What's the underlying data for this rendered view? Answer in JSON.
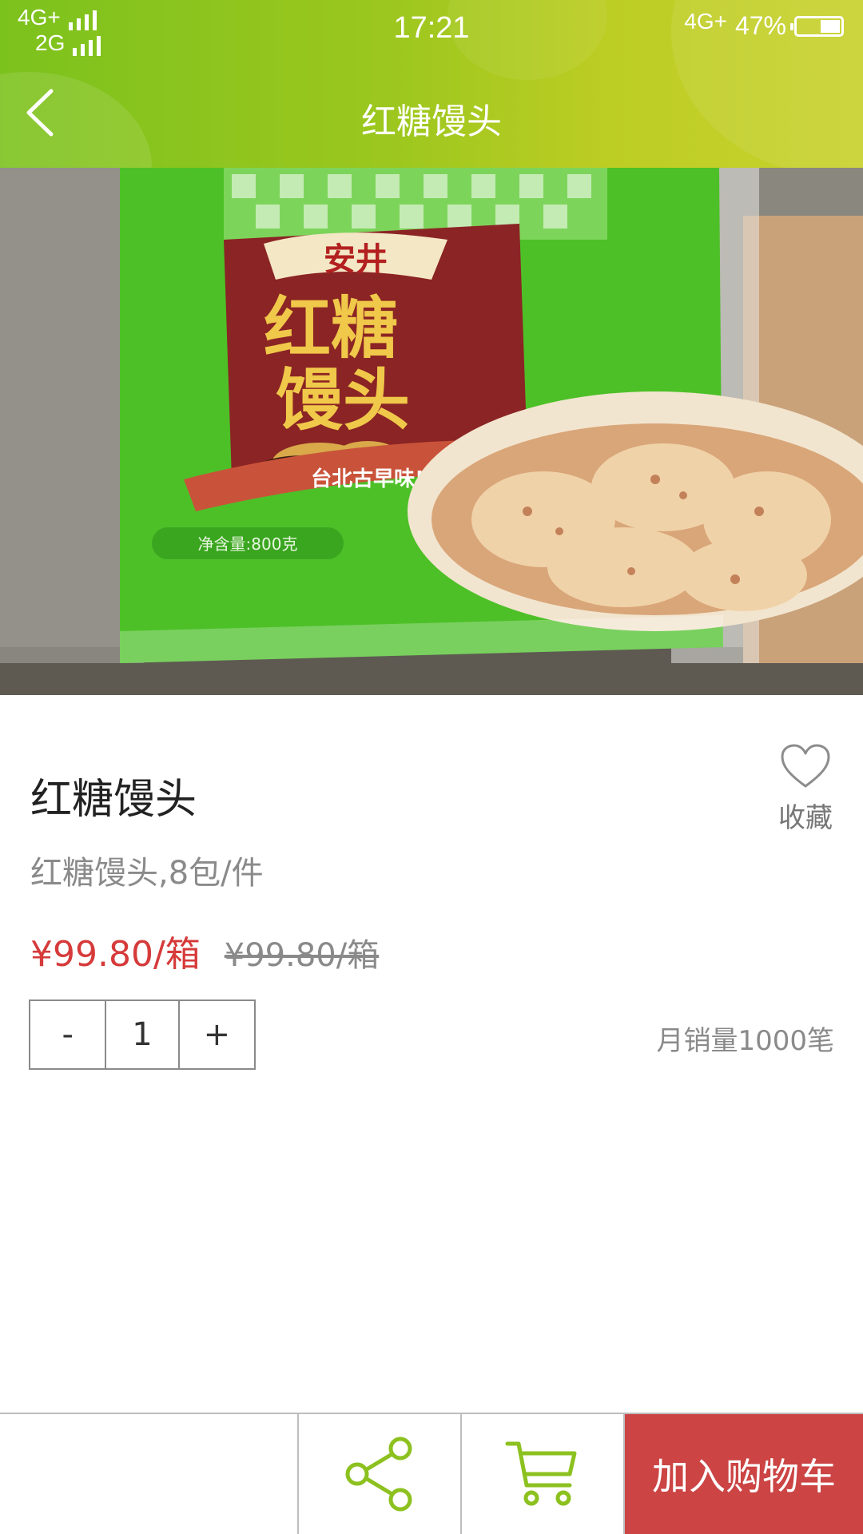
{
  "status_bar": {
    "network_primary": "4G+",
    "network_secondary": "2G",
    "time": "17:21",
    "network_right": "4G+",
    "battery_percent": "47%",
    "battery_level": 0.47
  },
  "header": {
    "title": "红糖馒头",
    "back_icon": "chevron-left-icon"
  },
  "product": {
    "image_label": "product-photo",
    "packaging": {
      "brand": "安井",
      "name_line1": "红糖",
      "name_line2": "馒头",
      "ribbon": "台北古早味!",
      "net_weight": "净含量:800克"
    },
    "name": "红糖馒头",
    "spec": "红糖馒头,8包/件",
    "price_current": "¥99.80/箱",
    "price_original": "¥99.80/箱",
    "favorite_label": "收藏",
    "favorite_icon": "heart-icon",
    "quantity": {
      "minus": "-",
      "value": "1",
      "plus": "+"
    },
    "monthly_sales": "月销量1000笔"
  },
  "bottom_bar": {
    "share_icon": "share-icon",
    "cart_icon": "cart-icon",
    "add_to_cart": "加入购物车"
  },
  "colors": {
    "header_green": "#8bc41f",
    "price_red": "#d63a3a",
    "cart_button_red": "#cc4444",
    "icon_green": "#8cc11f"
  }
}
